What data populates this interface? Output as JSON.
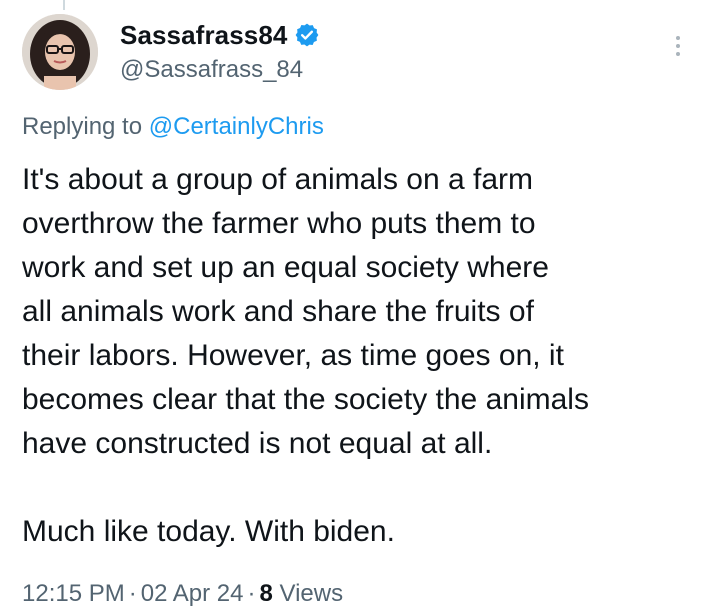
{
  "author": {
    "display_name": "Sassafrass84",
    "handle": "@Sassafrass_84",
    "verified_icon": "verified-badge-icon",
    "verified_color": "#1d9bf0"
  },
  "reply_context": {
    "prefix": "Replying to ",
    "mention": "@CertainlyChris"
  },
  "tweet": {
    "lines": [
      "It's about a group of animals on a farm",
      "overthrow the farmer who puts them to",
      "work and set up an equal society where",
      "all animals work and share the fruits of",
      "their labors. However, as time goes on, it",
      "becomes clear that the society the animals",
      "have constructed is not equal at all."
    ],
    "closing_line": "Much like today. With biden."
  },
  "meta": {
    "time": "12:15 PM",
    "separator": "·",
    "date": "02 Apr 24",
    "views_count": "8",
    "views_label": " Views"
  },
  "colors": {
    "text": "#0f1419",
    "secondary": "#536471",
    "link": "#1d9bf0"
  }
}
